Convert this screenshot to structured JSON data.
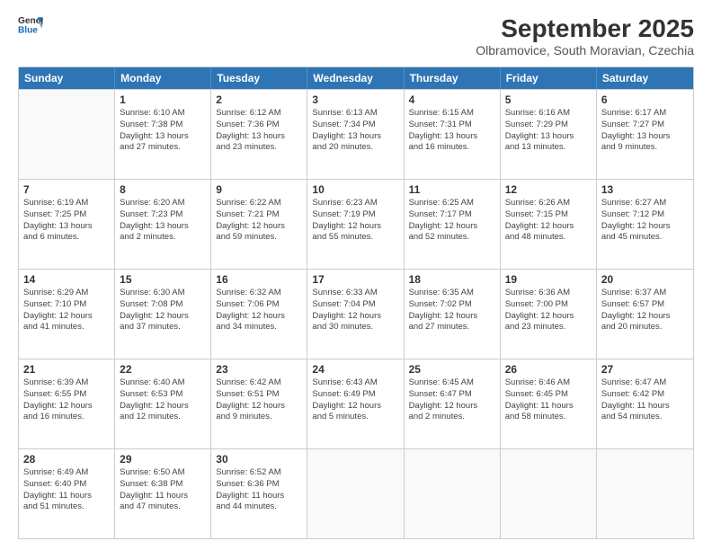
{
  "header": {
    "logo_general": "General",
    "logo_blue": "Blue",
    "month": "September 2025",
    "location": "Olbramovice, South Moravian, Czechia"
  },
  "weekdays": [
    "Sunday",
    "Monday",
    "Tuesday",
    "Wednesday",
    "Thursday",
    "Friday",
    "Saturday"
  ],
  "weeks": [
    [
      {
        "day": "",
        "info": ""
      },
      {
        "day": "1",
        "info": "Sunrise: 6:10 AM\nSunset: 7:38 PM\nDaylight: 13 hours\nand 27 minutes."
      },
      {
        "day": "2",
        "info": "Sunrise: 6:12 AM\nSunset: 7:36 PM\nDaylight: 13 hours\nand 23 minutes."
      },
      {
        "day": "3",
        "info": "Sunrise: 6:13 AM\nSunset: 7:34 PM\nDaylight: 13 hours\nand 20 minutes."
      },
      {
        "day": "4",
        "info": "Sunrise: 6:15 AM\nSunset: 7:31 PM\nDaylight: 13 hours\nand 16 minutes."
      },
      {
        "day": "5",
        "info": "Sunrise: 6:16 AM\nSunset: 7:29 PM\nDaylight: 13 hours\nand 13 minutes."
      },
      {
        "day": "6",
        "info": "Sunrise: 6:17 AM\nSunset: 7:27 PM\nDaylight: 13 hours\nand 9 minutes."
      }
    ],
    [
      {
        "day": "7",
        "info": "Sunrise: 6:19 AM\nSunset: 7:25 PM\nDaylight: 13 hours\nand 6 minutes."
      },
      {
        "day": "8",
        "info": "Sunrise: 6:20 AM\nSunset: 7:23 PM\nDaylight: 13 hours\nand 2 minutes."
      },
      {
        "day": "9",
        "info": "Sunrise: 6:22 AM\nSunset: 7:21 PM\nDaylight: 12 hours\nand 59 minutes."
      },
      {
        "day": "10",
        "info": "Sunrise: 6:23 AM\nSunset: 7:19 PM\nDaylight: 12 hours\nand 55 minutes."
      },
      {
        "day": "11",
        "info": "Sunrise: 6:25 AM\nSunset: 7:17 PM\nDaylight: 12 hours\nand 52 minutes."
      },
      {
        "day": "12",
        "info": "Sunrise: 6:26 AM\nSunset: 7:15 PM\nDaylight: 12 hours\nand 48 minutes."
      },
      {
        "day": "13",
        "info": "Sunrise: 6:27 AM\nSunset: 7:12 PM\nDaylight: 12 hours\nand 45 minutes."
      }
    ],
    [
      {
        "day": "14",
        "info": "Sunrise: 6:29 AM\nSunset: 7:10 PM\nDaylight: 12 hours\nand 41 minutes."
      },
      {
        "day": "15",
        "info": "Sunrise: 6:30 AM\nSunset: 7:08 PM\nDaylight: 12 hours\nand 37 minutes."
      },
      {
        "day": "16",
        "info": "Sunrise: 6:32 AM\nSunset: 7:06 PM\nDaylight: 12 hours\nand 34 minutes."
      },
      {
        "day": "17",
        "info": "Sunrise: 6:33 AM\nSunset: 7:04 PM\nDaylight: 12 hours\nand 30 minutes."
      },
      {
        "day": "18",
        "info": "Sunrise: 6:35 AM\nSunset: 7:02 PM\nDaylight: 12 hours\nand 27 minutes."
      },
      {
        "day": "19",
        "info": "Sunrise: 6:36 AM\nSunset: 7:00 PM\nDaylight: 12 hours\nand 23 minutes."
      },
      {
        "day": "20",
        "info": "Sunrise: 6:37 AM\nSunset: 6:57 PM\nDaylight: 12 hours\nand 20 minutes."
      }
    ],
    [
      {
        "day": "21",
        "info": "Sunrise: 6:39 AM\nSunset: 6:55 PM\nDaylight: 12 hours\nand 16 minutes."
      },
      {
        "day": "22",
        "info": "Sunrise: 6:40 AM\nSunset: 6:53 PM\nDaylight: 12 hours\nand 12 minutes."
      },
      {
        "day": "23",
        "info": "Sunrise: 6:42 AM\nSunset: 6:51 PM\nDaylight: 12 hours\nand 9 minutes."
      },
      {
        "day": "24",
        "info": "Sunrise: 6:43 AM\nSunset: 6:49 PM\nDaylight: 12 hours\nand 5 minutes."
      },
      {
        "day": "25",
        "info": "Sunrise: 6:45 AM\nSunset: 6:47 PM\nDaylight: 12 hours\nand 2 minutes."
      },
      {
        "day": "26",
        "info": "Sunrise: 6:46 AM\nSunset: 6:45 PM\nDaylight: 11 hours\nand 58 minutes."
      },
      {
        "day": "27",
        "info": "Sunrise: 6:47 AM\nSunset: 6:42 PM\nDaylight: 11 hours\nand 54 minutes."
      }
    ],
    [
      {
        "day": "28",
        "info": "Sunrise: 6:49 AM\nSunset: 6:40 PM\nDaylight: 11 hours\nand 51 minutes."
      },
      {
        "day": "29",
        "info": "Sunrise: 6:50 AM\nSunset: 6:38 PM\nDaylight: 11 hours\nand 47 minutes."
      },
      {
        "day": "30",
        "info": "Sunrise: 6:52 AM\nSunset: 6:36 PM\nDaylight: 11 hours\nand 44 minutes."
      },
      {
        "day": "",
        "info": ""
      },
      {
        "day": "",
        "info": ""
      },
      {
        "day": "",
        "info": ""
      },
      {
        "day": "",
        "info": ""
      }
    ]
  ]
}
